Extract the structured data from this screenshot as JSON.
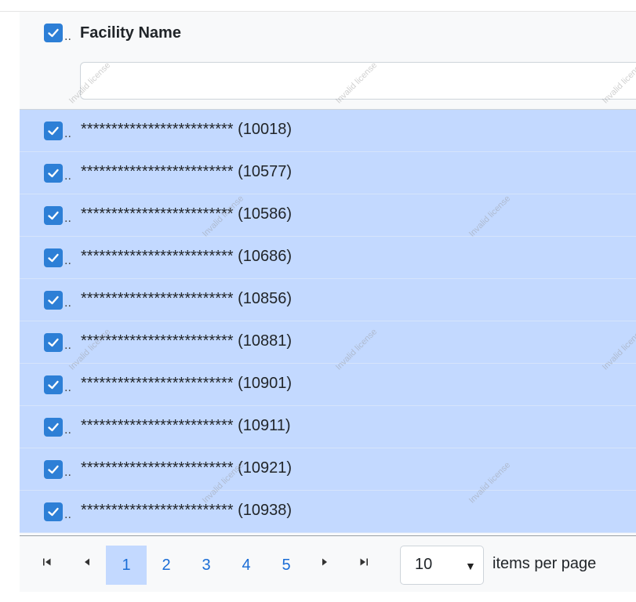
{
  "header": {
    "column_title": "Facility Name",
    "filter_placeholder": ""
  },
  "rows": [
    {
      "label": "************************* (10018)"
    },
    {
      "label": "************************* (10577)"
    },
    {
      "label": "************************* (10586)"
    },
    {
      "label": "************************* (10686)"
    },
    {
      "label": "************************* (10856)"
    },
    {
      "label": "************************* (10881)"
    },
    {
      "label": "************************* (10901)"
    },
    {
      "label": "************************* (10911)"
    },
    {
      "label": "************************* (10921)"
    },
    {
      "label": "************************* (10938)"
    }
  ],
  "truncation": "..",
  "pager": {
    "pages": [
      "1",
      "2",
      "3",
      "4",
      "5"
    ],
    "current_page": "1",
    "page_size": "10",
    "items_per_page_label": "items per page"
  },
  "watermark": "Invalid license",
  "colors": {
    "accent": "#2d7fd6",
    "selected_row": "#c3d9ff",
    "link": "#1a6dd6"
  },
  "icons": {
    "first": "first-page-icon",
    "prev": "previous-page-icon",
    "next": "next-page-icon",
    "last": "last-page-icon",
    "dropdown": "chevron-down-icon",
    "check": "checkmark-icon"
  }
}
